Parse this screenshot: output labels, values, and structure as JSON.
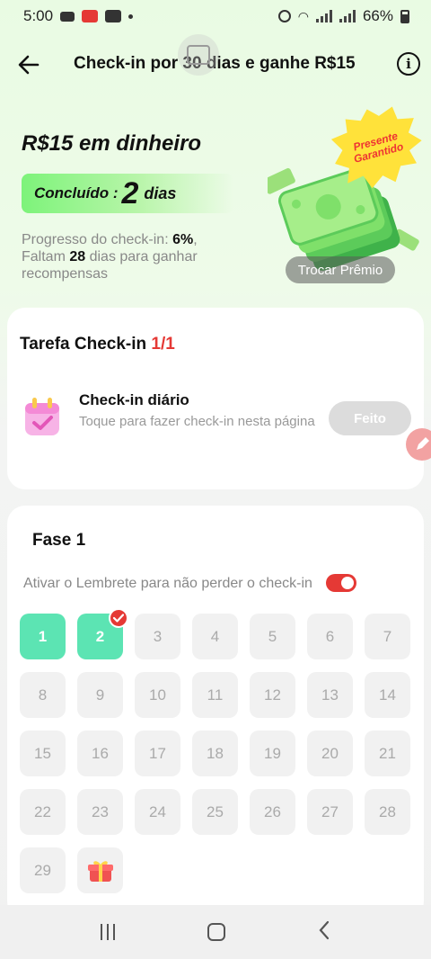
{
  "status_bar": {
    "time": "5:00",
    "battery": "66%"
  },
  "header": {
    "title": "Check-in por 30 dias e ganhe R$15",
    "info_label": "i"
  },
  "hero": {
    "amount_label": "R$15 em dinheiro",
    "done_label": "Concluído :",
    "done_count": "2",
    "done_unit": "dias",
    "progress_prefix": "Progresso do check-in: ",
    "progress_value": "6%",
    "progress_suffix": ",",
    "remaining_prefix": "Faltam ",
    "remaining_value": "28",
    "remaining_suffix": " dias para ganhar recompensas",
    "badge_line1": "Presente",
    "badge_line2": "Garantido",
    "exchange_button": "Trocar Prêmio"
  },
  "task_card": {
    "title": "Tarefa Check-in ",
    "count": "1/1",
    "task_name": "Check-in diário",
    "task_desc": "Toque para fazer check-in nesta página",
    "done_button": "Feito"
  },
  "phase_card": {
    "title": "Fase 1",
    "reminder_text": "Ativar o Lembrete para não perder o check-in",
    "reminder_enabled": true,
    "days": [
      "1",
      "2",
      "3",
      "4",
      "5",
      "6",
      "7",
      "8",
      "9",
      "10",
      "11",
      "12",
      "13",
      "14",
      "15",
      "16",
      "17",
      "18",
      "19",
      "20",
      "21",
      "22",
      "23",
      "24",
      "25",
      "26",
      "27",
      "28",
      "29"
    ],
    "completed_days": 2,
    "final_reward_icon": "gift-icon"
  },
  "colors": {
    "accent_red": "#e53935",
    "done_green": "#5ce4b3",
    "highlight_green": "#7df37a"
  }
}
